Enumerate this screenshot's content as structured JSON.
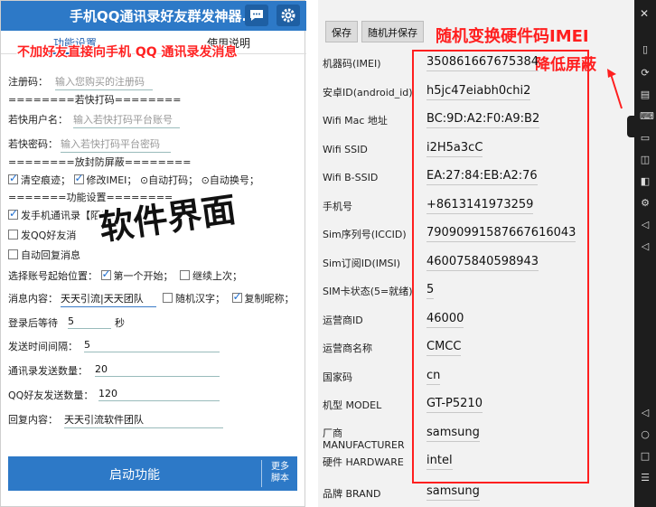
{
  "left_app": {
    "title": "手机QQ通讯录好友群发神器.",
    "tabs": [
      "功能设置",
      "使用说明"
    ],
    "overlay_caption": "不加好友直接向手机 QQ 通讯录发消息",
    "reg_label": "注册码：",
    "reg_placeholder": "输入您购买的注册码",
    "sec_captcha": "========若快打码========",
    "rk_user_label": "若快用户名：",
    "rk_user_placeholder": "输入若快打码平台账号",
    "rk_pass_label": "若快密码：",
    "rk_pass_placeholder": "输入若快打码平台密码",
    "sec_antiban": "========放封防屏蔽========",
    "opt_clear": "清空痕迹；",
    "opt_imei": "修改IMEI；",
    "opt_auto_captcha": "⊙自动打码；",
    "opt_auto_switch": "⊙自动换号；",
    "sec_func": "=======功能设置========",
    "opt_send_contacts": "发手机通讯录【陌生人】",
    "opt_send_qq": "发QQ好友消",
    "opt_auto_reply": "自动回复消息",
    "big_label": "软件界面",
    "start_pos_label": "选择账号起始位置：",
    "opt_first": "第一个开始；",
    "opt_continue": "继续上次；",
    "msg_label": "消息内容：",
    "msg_value": "天天引流|天天团队",
    "opt_random_chars": "随机汉字；",
    "opt_copy_nick": "复制昵称；",
    "wait_label": "登录后等待",
    "wait_value": "5",
    "wait_unit": "秒",
    "interval_label": "发送时间间隔：",
    "interval_value": "5",
    "contacts_count_label": "通讯录发送数量：",
    "contacts_count_value": "20",
    "qq_count_label": "QQ好友发送数量：",
    "qq_count_value": "120",
    "reply_label": "回复内容：",
    "reply_value": "天天引流软件团队",
    "start_button": "启动功能",
    "more_button": "更多\n脚本"
  },
  "right_app": {
    "save_button": "保存",
    "random_save_button": "随机并保存",
    "overlay_title": "随机变换硬件码IMEI",
    "overlay_sub": "降低屏蔽",
    "fields": [
      {
        "label": "机器码(IMEI)",
        "value": "350861667675384"
      },
      {
        "label": "安卓ID(android_id)",
        "value": "h5jc47eiabh0chi2"
      },
      {
        "label": "Wifi Mac 地址",
        "value": "BC:9D:A2:F0:A9:B2"
      },
      {
        "label": "Wifi SSID",
        "value": "i2H5a3cC"
      },
      {
        "label": "Wifi B-SSID",
        "value": "EA:27:84:EB:A2:76"
      },
      {
        "label": "手机号",
        "value": "+8613141973259"
      },
      {
        "label": "Sim序列号(ICCID)",
        "value": "79090991587667616043"
      },
      {
        "label": "Sim订阅ID(IMSI)",
        "value": "460075840598943"
      },
      {
        "label": "SIM卡状态(5=就绪)",
        "value": "5"
      },
      {
        "label": "运营商ID",
        "value": "46000"
      },
      {
        "label": "运营商名称",
        "value": "CMCC"
      },
      {
        "label": "国家码",
        "value": "cn"
      },
      {
        "label": "机型 MODEL",
        "value": "GT-P5210"
      },
      {
        "label": "厂商\nMANUFACTURER",
        "value": "samsung"
      },
      {
        "label": "硬件 HARDWARE",
        "value": "intel"
      },
      {
        "label": "品牌 BRAND",
        "value": "samsung"
      }
    ]
  },
  "colors": {
    "header_blue": "#2d79c7",
    "accent_red": "#ff1f1f",
    "sidebar_dark": "#1d1d1d"
  }
}
